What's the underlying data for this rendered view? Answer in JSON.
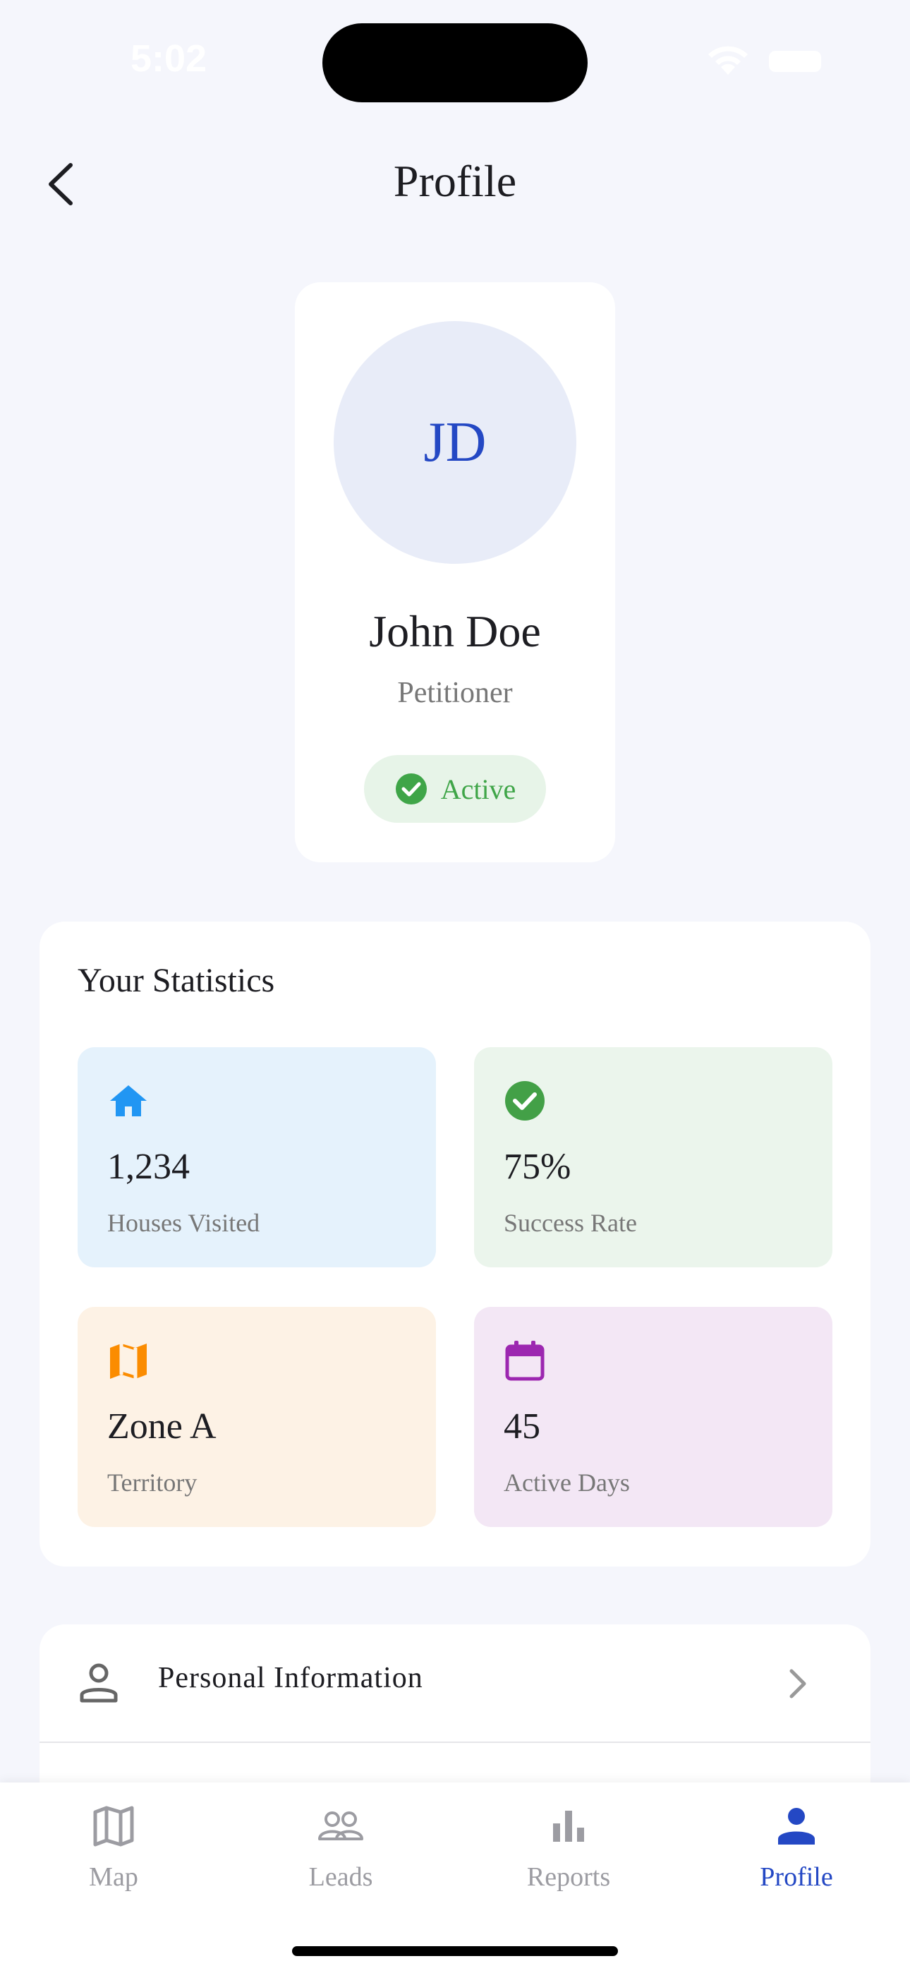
{
  "status_bar": {
    "time": "5:02"
  },
  "header": {
    "title": "Profile"
  },
  "profile": {
    "initials": "JD",
    "name": "John Doe",
    "role": "Petitioner",
    "status": "Active"
  },
  "statistics": {
    "title": "Your Statistics",
    "tiles": [
      {
        "icon": "home-icon",
        "value": "1,234",
        "label": "Houses Visited",
        "color": "#2196f3"
      },
      {
        "icon": "check-circle-icon",
        "value": "75%",
        "label": "Success Rate",
        "color": "#43a047"
      },
      {
        "icon": "map-icon",
        "value": "Zone A",
        "label": "Territory",
        "color": "#fb8c00"
      },
      {
        "icon": "calendar-icon",
        "value": "45",
        "label": "Active Days",
        "color": "#9c27b0"
      }
    ]
  },
  "menu": {
    "items": [
      {
        "icon": "person-icon",
        "label": "Personal Information"
      }
    ]
  },
  "tab_bar": {
    "tabs": [
      {
        "icon": "map-outline-icon",
        "label": "Map"
      },
      {
        "icon": "people-icon",
        "label": "Leads"
      },
      {
        "icon": "bar-chart-icon",
        "label": "Reports"
      },
      {
        "icon": "person-filled-icon",
        "label": "Profile",
        "active": true
      }
    ]
  },
  "colors": {
    "accent": "#2448c4",
    "active_green": "#3fa548",
    "background": "#f5f6fc"
  }
}
